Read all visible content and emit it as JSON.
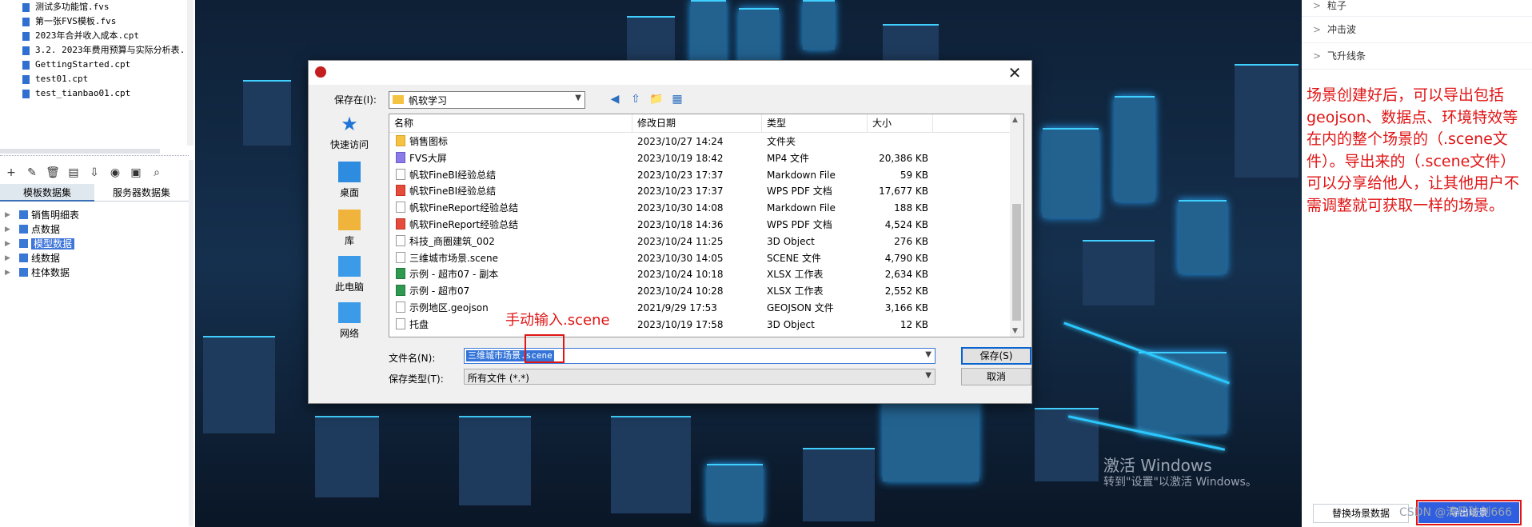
{
  "left_panel": {
    "files": [
      "测试多功能馆.fvs",
      "第一张FVS模板.fvs",
      "2023年合并收入成本.cpt",
      "3.2. 2023年费用预算与实际分析表.",
      "GettingStarted.cpt",
      "test01.cpt",
      "test_tianbao01.cpt"
    ],
    "toolbar_icons": [
      "add-icon",
      "edit-icon",
      "delete-icon",
      "preview-icon",
      "export-icon",
      "database-icon",
      "server-icon",
      "search-icon"
    ],
    "tabs": [
      "模板数据集",
      "服务器数据集"
    ],
    "datasets": [
      "销售明细表",
      "点数据",
      "模型数据",
      "线数据",
      "柱体数据"
    ],
    "selected_dataset": "模型数据"
  },
  "dialog": {
    "savein_label": "保存在(I):",
    "savein_value": "帆软学习",
    "places": [
      "快速访问",
      "桌面",
      "库",
      "此电脑",
      "网络"
    ],
    "columns": [
      "名称",
      "修改日期",
      "类型",
      "大小"
    ],
    "files": [
      {
        "name": "销售图标",
        "date": "2023/10/27 14:24",
        "type": "文件夹",
        "size": "",
        "icon": "folder"
      },
      {
        "name": "FVS大屏",
        "date": "2023/10/19 18:42",
        "type": "MP4 文件",
        "size": "20,386 KB",
        "icon": "mp4"
      },
      {
        "name": "帆软FineBI经验总结",
        "date": "2023/10/23 17:37",
        "type": "Markdown File",
        "size": "59 KB",
        "icon": "md"
      },
      {
        "name": "帆软FineBI经验总结",
        "date": "2023/10/23 17:37",
        "type": "WPS PDF 文档",
        "size": "17,677 KB",
        "icon": "pdf"
      },
      {
        "name": "帆软FineReport经验总结",
        "date": "2023/10/30 14:08",
        "type": "Markdown File",
        "size": "188 KB",
        "icon": "md"
      },
      {
        "name": "帆软FineReport经验总结",
        "date": "2023/10/18 14:36",
        "type": "WPS PDF 文档",
        "size": "4,524 KB",
        "icon": "pdf"
      },
      {
        "name": "科技_商圈建筑_002",
        "date": "2023/10/24 11:25",
        "type": "3D Object",
        "size": "276 KB",
        "icon": "md"
      },
      {
        "name": "三维城市场景.scene",
        "date": "2023/10/30 14:05",
        "type": "SCENE 文件",
        "size": "4,790 KB",
        "icon": "md"
      },
      {
        "name": "示例 - 超市07 - 副本",
        "date": "2023/10/24 10:18",
        "type": "XLSX 工作表",
        "size": "2,634 KB",
        "icon": "xlsx"
      },
      {
        "name": "示例 - 超市07",
        "date": "2023/10/24 10:28",
        "type": "XLSX 工作表",
        "size": "2,552 KB",
        "icon": "xlsx"
      },
      {
        "name": "示例地区.geojson",
        "date": "2021/9/29 17:53",
        "type": "GEOJSON 文件",
        "size": "3,166 KB",
        "icon": "md"
      },
      {
        "name": "托盘",
        "date": "2023/10/19 17:58",
        "type": "3D Object",
        "size": "12 KB",
        "icon": "md"
      }
    ],
    "filename_label": "文件名(N):",
    "filename_value": "三维城市场景.scene",
    "filetype_label": "保存类型(T):",
    "filetype_value": "所有文件 (*.*)",
    "save_label": "保存(S)",
    "cancel_label": "取消"
  },
  "annotations": {
    "manual_input": "手动输入.scene",
    "export_note": "场景创建好后，可以导出包括geojson、数据点、环境特效等在内的整个场景的（.scene文件）。导出来的（.scene文件）可以分享给他人，让其他用户不需调整就可获取一样的场景。"
  },
  "right_panel": {
    "items": [
      "粒子",
      "冲击波",
      "飞升线条"
    ],
    "replace_label": "替换场景数据",
    "export_label": "导出场景"
  },
  "watermark": {
    "title": "激活 Windows",
    "subtitle": "转到\"设置\"以激活 Windows。",
    "csdn": "CSDN @清风破剑666"
  },
  "colors": {
    "accent": "#2f5fe0",
    "annotation_red": "#e01414",
    "neon": "#3fd0ff"
  }
}
